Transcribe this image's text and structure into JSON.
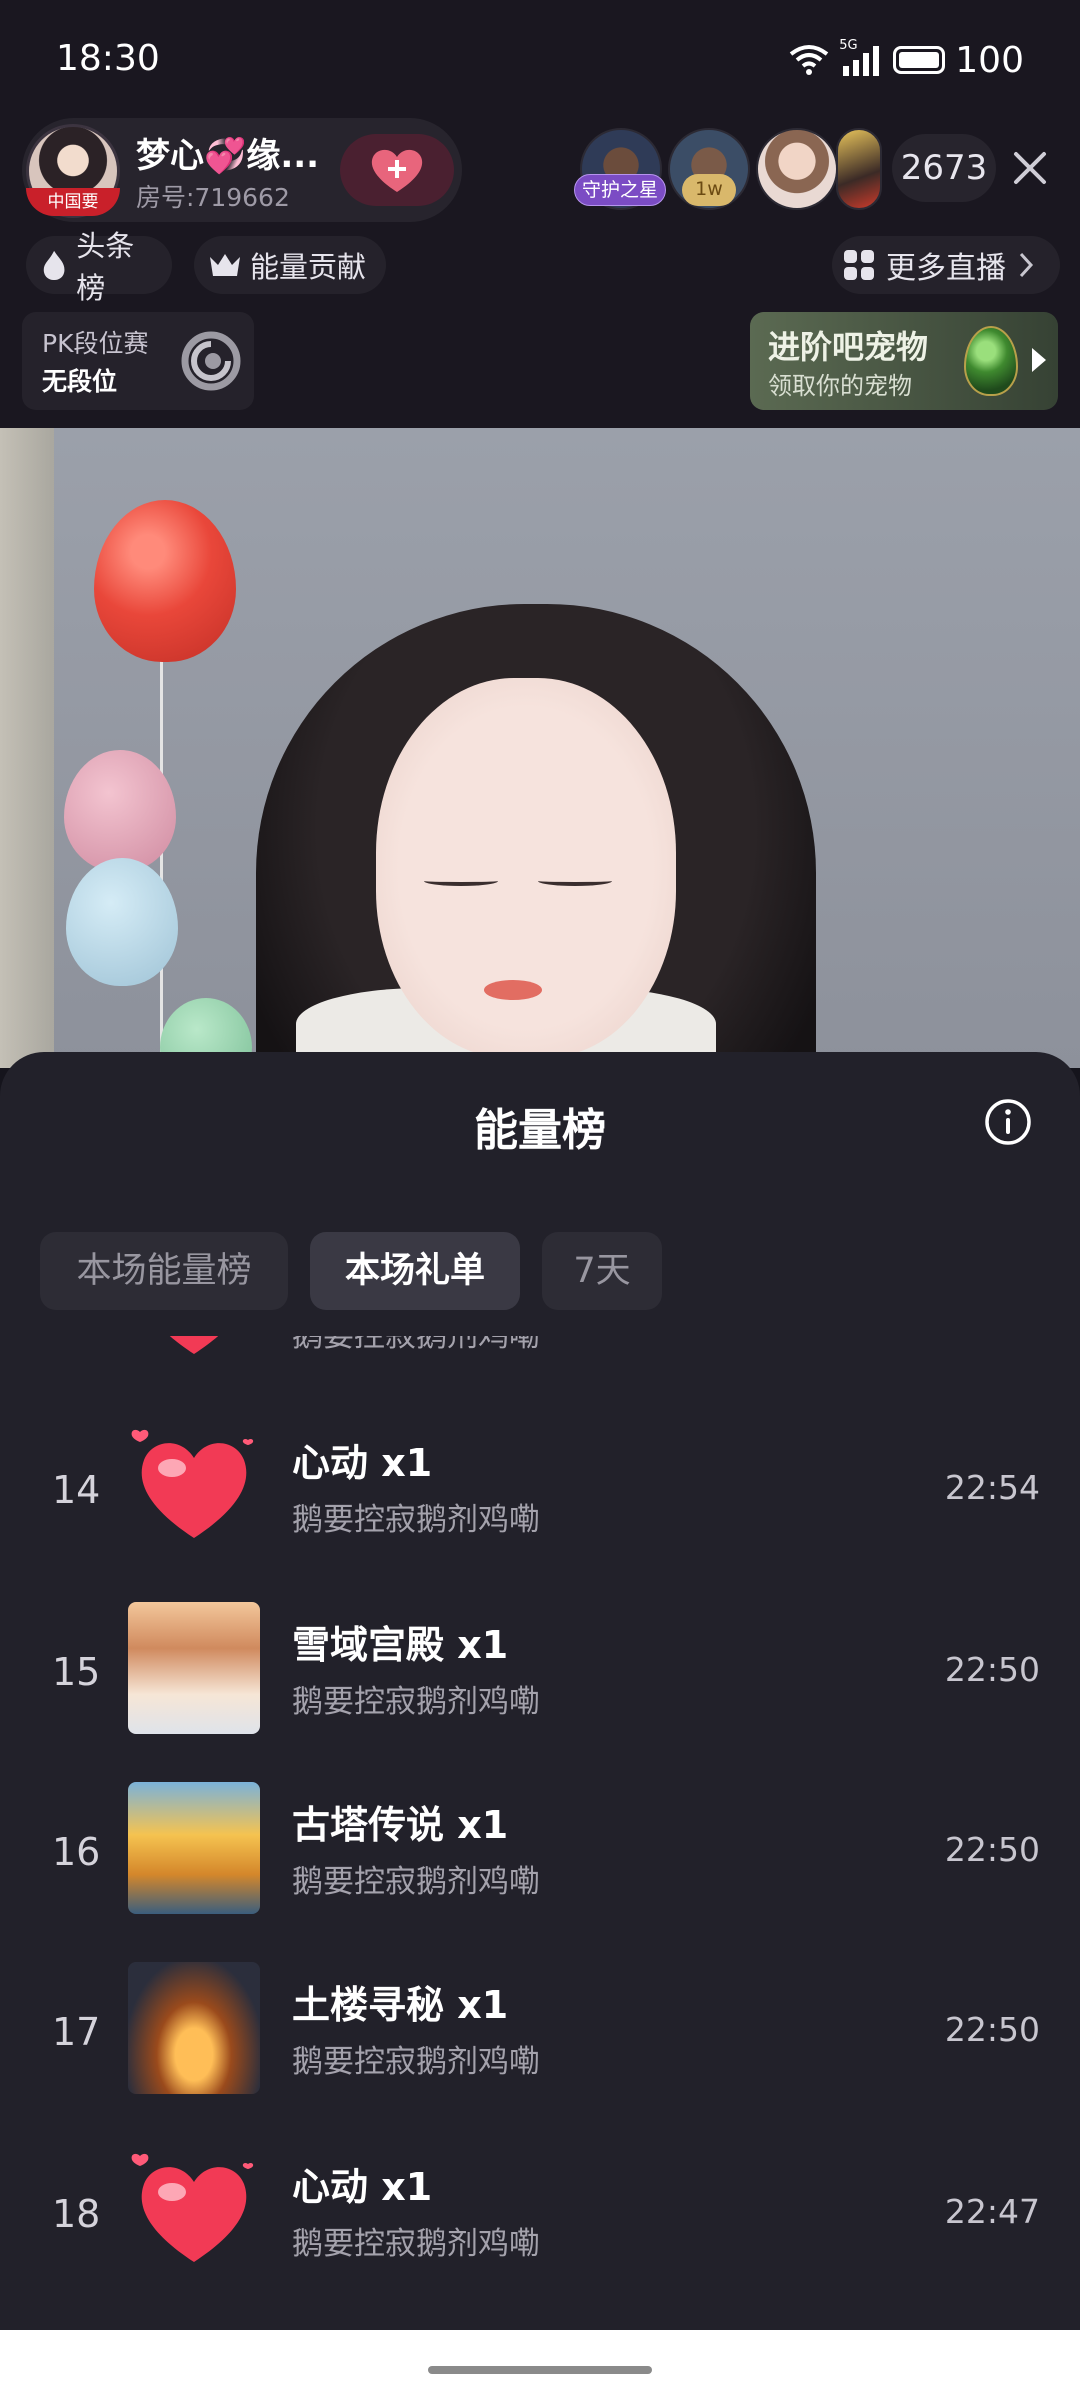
{
  "status_bar": {
    "time": "18:30",
    "network": "5G",
    "battery": "100"
  },
  "host": {
    "name": "梦心💞缘...",
    "room_id": "房号:719662",
    "avatar_tag": "中国要"
  },
  "viewers": {
    "badge_guard": "守护之星",
    "badge_rank": "1w",
    "count": "2673"
  },
  "rank_chips": {
    "hot": "头条榜",
    "energy": "能量贡献",
    "more_live": "更多直播"
  },
  "pk": {
    "title": "PK段位赛",
    "status": "无段位"
  },
  "pet_banner": {
    "title": "进阶吧宠物",
    "subtitle": "领取你的宠物"
  },
  "sheet": {
    "title": "能量榜",
    "tabs": [
      "本场能量榜",
      "本场礼单",
      "7天"
    ],
    "active_tab": "本场礼单",
    "partial_row": {
      "sender": "鹅要控寂鹅剂鸡嘞"
    },
    "rows": [
      {
        "rank": "14",
        "gift": "心动  x1",
        "sender": "鹅要控寂鹅剂鸡嘞",
        "time": "22:54",
        "icon": "heart-icon"
      },
      {
        "rank": "15",
        "gift": "雪域宫殿  x1",
        "sender": "鹅要控寂鹅剂鸡嘞",
        "time": "22:50",
        "icon": "palace-icon"
      },
      {
        "rank": "16",
        "gift": "古塔传说  x1",
        "sender": "鹅要控寂鹅剂鸡嘞",
        "time": "22:50",
        "icon": "tower-icon"
      },
      {
        "rank": "17",
        "gift": "土楼寻秘  x1",
        "sender": "鹅要控寂鹅剂鸡嘞",
        "time": "22:50",
        "icon": "tulou-icon"
      },
      {
        "rank": "18",
        "gift": "心动  x1",
        "sender": "鹅要控寂鹅剂鸡嘞",
        "time": "22:47",
        "icon": "heart-icon"
      }
    ]
  },
  "colors": {
    "sheet_bg": "#22212a",
    "active_tab": "#3a3944",
    "heart": "#f23a55"
  }
}
